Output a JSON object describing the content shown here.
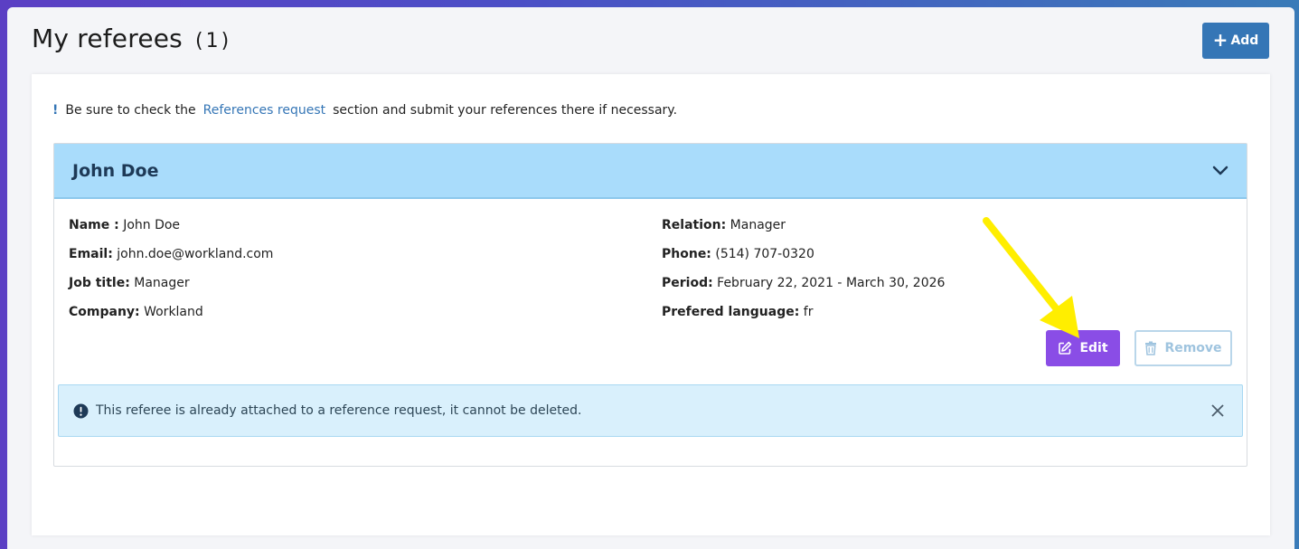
{
  "header": {
    "title": "My referees",
    "count": "(1)",
    "add_label": "Add"
  },
  "notice": {
    "bang": "!",
    "before": "Be sure to check the",
    "link": "References request",
    "after": "section and submit your references there if necessary."
  },
  "referee": {
    "name": "John Doe",
    "fields_left": [
      {
        "label": "Name :",
        "value": "John Doe"
      },
      {
        "label": "Email:",
        "value": "john.doe@workland.com"
      },
      {
        "label": "Job title:",
        "value": "Manager"
      },
      {
        "label": "Company:",
        "value": "Workland"
      }
    ],
    "fields_right": [
      {
        "label": "Relation:",
        "value": "Manager"
      },
      {
        "label": "Phone:",
        "value": "(514) 707-0320"
      },
      {
        "label": "Period:",
        "value": "February 22, 2021 - March 30, 2026"
      },
      {
        "label": "Prefered language:",
        "value": "fr"
      }
    ],
    "edit_label": "Edit",
    "remove_label": "Remove"
  },
  "alert": {
    "message": "This referee is already attached to a reference request, it cannot be deleted."
  },
  "icons": {
    "add": "plus-icon",
    "expand": "chevron-down-icon",
    "edit": "edit-icon",
    "remove": "trash-icon",
    "alert": "exclamation-circle-icon",
    "close": "close-icon",
    "annotation": "arrow-icon"
  },
  "colors": {
    "accent": "#3576b6",
    "edit": "#8a4de6",
    "header_bg": "#a9dcfb",
    "alert_bg": "#d9f0fc",
    "annotation": "#ffee00"
  }
}
